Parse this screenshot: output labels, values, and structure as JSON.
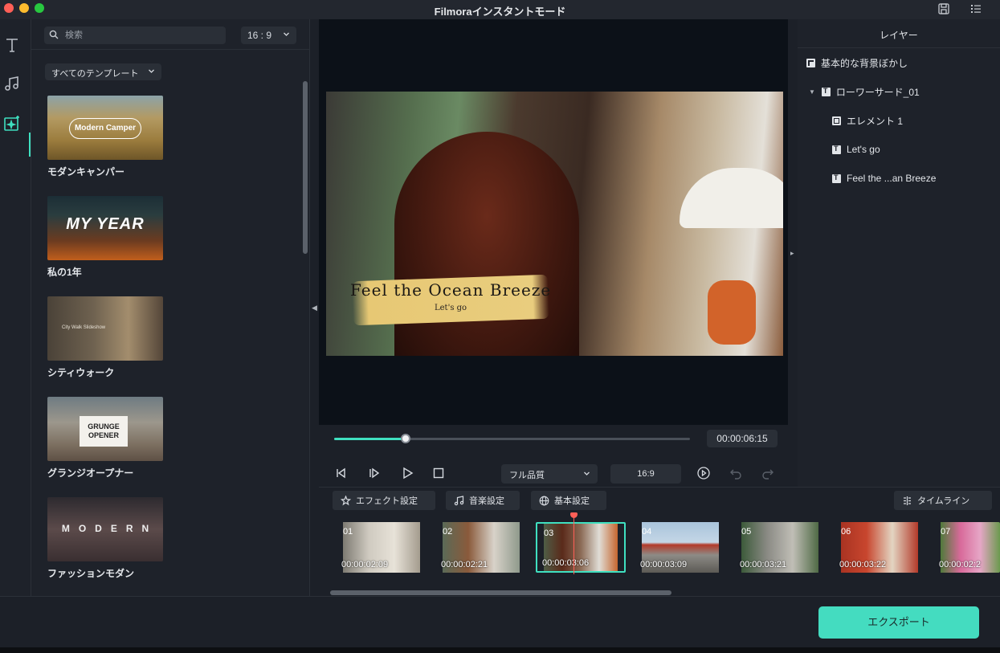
{
  "window": {
    "title": "Filmoraインスタントモード"
  },
  "sidebar": {
    "search_placeholder": "検索",
    "aspect_ratio": "16 : 9",
    "filter_label": "すべてのテンプレート",
    "templates": [
      {
        "label": "モダンキャンパー",
        "thumb_text": "Modern Camper"
      },
      {
        "label": "私の1年",
        "thumb_text": "MY YEAR"
      },
      {
        "label": "シティウォーク",
        "thumb_text": "City Walk Slideshow"
      },
      {
        "label": "グランジオープナー",
        "thumb_text": "GRUNGE OPENER"
      },
      {
        "label": "ファッションモダン",
        "thumb_text": "MODERN"
      }
    ]
  },
  "preview": {
    "overlay_title": "Feel the Ocean Breeze",
    "overlay_subtitle": "Let's go",
    "progress_fraction": 0.2,
    "timecode": "00:00:06:15",
    "quality": "フル品質",
    "ratio": "16:9"
  },
  "layers": {
    "header": "レイヤー",
    "items": [
      {
        "label": "基本的な背景ぼかし",
        "icon": "image-icon"
      },
      {
        "label": "ローワーサード_01",
        "icon": "text-icon"
      },
      {
        "label": "エレメント 1",
        "icon": "element-icon"
      },
      {
        "label": "Let's go",
        "icon": "text-icon"
      },
      {
        "label": "Feel the ...an Breeze",
        "icon": "text-icon"
      }
    ]
  },
  "settings_tabs": {
    "effect": "エフェクト設定",
    "music": "音楽設定",
    "basic": "基本設定",
    "timeline": "タイムライン"
  },
  "clips": [
    {
      "num": "01",
      "duration": "00:00:02:09"
    },
    {
      "num": "02",
      "duration": "00:00:02:21"
    },
    {
      "num": "03",
      "duration": "00:00:03:06"
    },
    {
      "num": "04",
      "duration": "00:00:03:09"
    },
    {
      "num": "05",
      "duration": "00:00:03:21"
    },
    {
      "num": "06",
      "duration": "00:00:03:22"
    },
    {
      "num": "07",
      "duration": "00:00:02:2"
    }
  ],
  "export_label": "エクスポート",
  "colors": {
    "accent": "#3fe0c0",
    "export": "#44dcc0",
    "playhead": "#ff5f57"
  }
}
